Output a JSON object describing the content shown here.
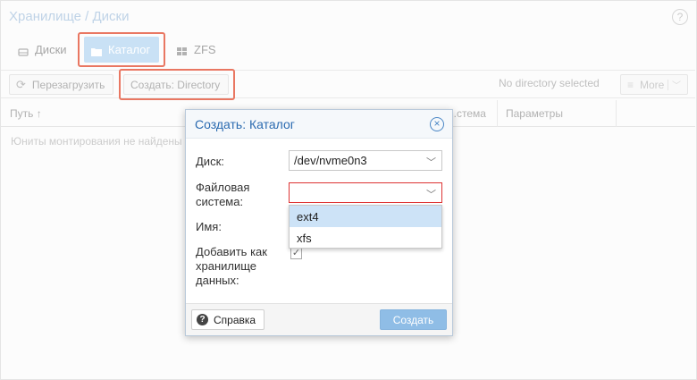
{
  "panel": {
    "title": "Хранилище / Диски",
    "help_icon": "?"
  },
  "tabs": [
    {
      "label": "Диски",
      "icon": "disk-icon"
    },
    {
      "label": "Каталог",
      "icon": "folder-icon",
      "active": true
    },
    {
      "label": "ZFS",
      "icon": "grid-icon"
    }
  ],
  "toolbar": {
    "reload_label": "Перезагрузить",
    "create_label": "Создать: Directory",
    "status_text": "No directory selected",
    "more_label": "More"
  },
  "table": {
    "columns": [
      "Путь ↑",
      "",
      "...стема",
      "Параметры"
    ],
    "empty_text": "Юниты монтирования не найдены"
  },
  "dialog": {
    "title": "Создать: Каталог",
    "disk_label": "Диск:",
    "disk_value": "/dev/nvme0n3",
    "fs_label_line1": "Файловая",
    "fs_label_line2": "система:",
    "fs_value": "",
    "name_label": "Имя:",
    "add_storage_line1": "Добавить как",
    "add_storage_line2": "хранилище",
    "add_storage_line3": "данных:",
    "add_storage_checked": true,
    "fs_options": [
      "ext4",
      "xfs"
    ],
    "fs_selected_option": "ext4",
    "help_label": "Справка",
    "create_label": "Создать"
  },
  "colors": {
    "accent": "#2a6ab0",
    "highlight": "#e24a2e",
    "active_tab": "#b7d7f2",
    "invalid": "#dd3333"
  }
}
